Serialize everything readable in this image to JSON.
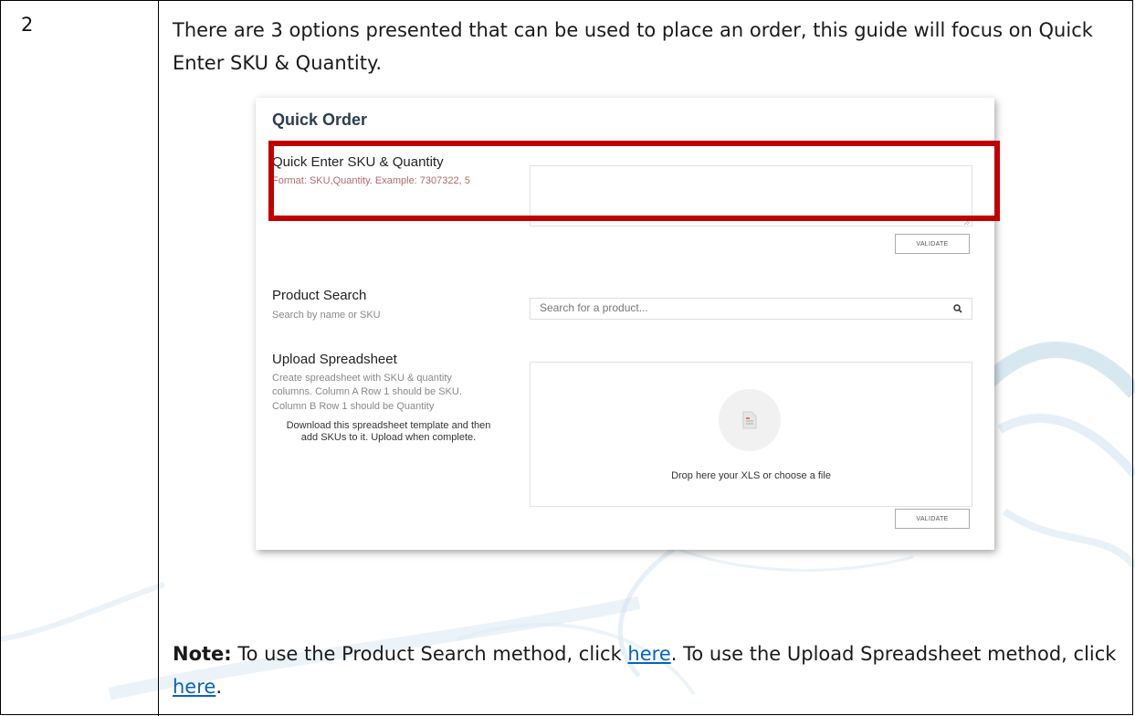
{
  "step_number": "2",
  "intro_text": "There are 3 options presented that can be used to place an order, this guide will focus on Quick Enter SKU & Quantity.",
  "quick_order": {
    "title": "Quick Order",
    "quick_enter": {
      "title": "Quick Enter SKU & Quantity",
      "subtitle": "Format: SKU,Quantity. Example: 7307322, 5",
      "textarea_value": "",
      "validate_label": "VALIDATE"
    },
    "product_search": {
      "title": "Product Search",
      "subtitle": "Search by name or SKU",
      "placeholder": "Search for a product...",
      "icon": "search-icon"
    },
    "upload": {
      "title": "Upload Spreadsheet",
      "desc_line1": "Create spreadsheet with SKU & quantity",
      "desc_line2": "columns. Column A Row 1 should be SKU.",
      "desc_line3": "Column B Row 1 should be Quantity",
      "template_line1": "Download this spreadsheet template and then",
      "template_line2": "add SKUs to it. Upload when complete.",
      "drop_text": "Drop here your XLS or choose a file",
      "icon": "file-icon",
      "validate_label": "VALIDATE"
    }
  },
  "note": {
    "label": "Note:",
    "text1": " To use the Product Search method, click ",
    "link1": "here",
    "text2": ". To use the Upload Spreadsheet method, click ",
    "link2": "here",
    "text3": "."
  },
  "colors": {
    "highlight": "#c00000",
    "link": "#0563c1",
    "title": "#2c3e50"
  }
}
